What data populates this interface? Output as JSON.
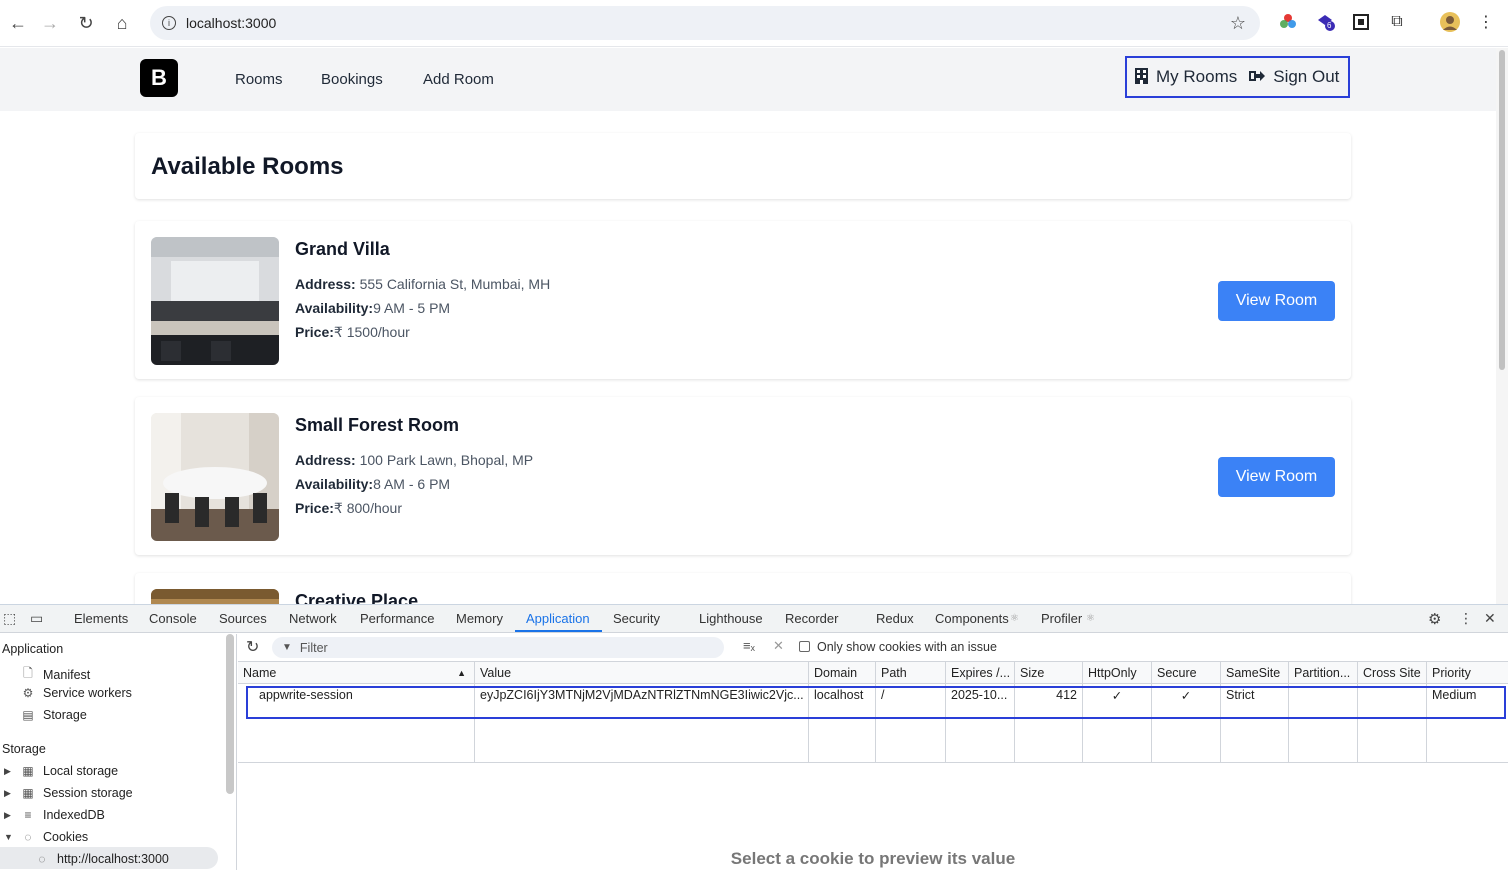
{
  "browser": {
    "url": "localhost:3000",
    "extension_badge": "6"
  },
  "nav": {
    "logo": "B",
    "links": [
      "Rooms",
      "Bookings",
      "Add Room"
    ],
    "my_rooms": "My Rooms",
    "sign_out": "Sign Out"
  },
  "main": {
    "heading": "Available Rooms",
    "rooms": [
      {
        "name": "Grand Villa",
        "address_label": "Address:",
        "address": "555 California St, Mumbai, MH",
        "availability_label": "Availability:",
        "availability": "9 AM - 5 PM",
        "price_label": "Price:",
        "price": "₹ 1500/hour",
        "button": "View Room"
      },
      {
        "name": "Small Forest Room",
        "address_label": "Address:",
        "address": "100 Park Lawn, Bhopal, MP",
        "availability_label": "Availability:",
        "availability": "8 AM - 6 PM",
        "price_label": "Price:",
        "price": "₹ 800/hour",
        "button": "View Room"
      },
      {
        "name": "Creative Place"
      }
    ]
  },
  "devtools": {
    "tabs": [
      "Elements",
      "Console",
      "Sources",
      "Network",
      "Performance",
      "Memory",
      "Application",
      "Security",
      "Lighthouse",
      "Recorder",
      "Redux",
      "Components",
      "Profiler"
    ],
    "active_tab": "Application",
    "sidebar": {
      "application_header": "Application",
      "application_items": [
        "Manifest",
        "Service workers",
        "Storage"
      ],
      "storage_header": "Storage",
      "storage_items": [
        "Local storage",
        "Session storage",
        "IndexedDB",
        "Cookies"
      ],
      "cookie_origin": "http://localhost:3000"
    },
    "toolbar": {
      "filter_placeholder": "Filter",
      "only_issues_label": "Only show cookies with an issue"
    },
    "columns": [
      "Name",
      "Value",
      "Domain",
      "Path",
      "Expires /...",
      "Size",
      "HttpOnly",
      "Secure",
      "SameSite",
      "Partition...",
      "Cross Site",
      "Priority"
    ],
    "cookie": {
      "name": "appwrite-session",
      "value": "eyJpZCI6IjY3MTNjM2VjMDAzNTRlZTNmNGE3Iiwic2Vjc...",
      "domain": "localhost",
      "path": "/",
      "expires": "2025-10...",
      "size": "412",
      "httponly": "✓",
      "secure": "✓",
      "samesite": "Strict",
      "partition": "",
      "cross_site": "",
      "priority": "Medium"
    },
    "preview_text": "Select a cookie to preview its value"
  }
}
